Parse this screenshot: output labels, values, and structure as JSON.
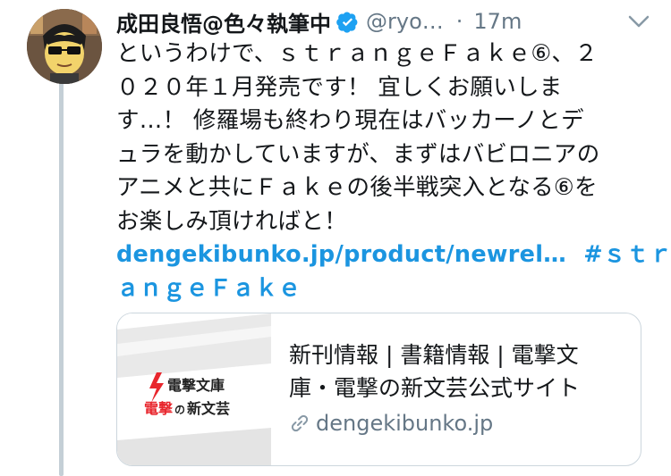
{
  "tweet": {
    "display_name": "成田良悟@色々執筆中",
    "handle": "@ryo…",
    "separator": "·",
    "timestamp": "17m",
    "body_lines": [
      "というわけで、ｓｔｒａｎｇｅＦａｋｅ⑥、２",
      "０２０年１月発売です！ 宜しくお願いしま",
      "す…！ 修羅場も終わり現在はバッカーノとデ",
      "ュラを動かしていますが、まずはバビロニアの",
      "アニメと共にＦａｋｅの後半戦突入となる⑥を",
      "お楽しみ頂ければと！"
    ],
    "link_text": "dengekibunko.jp/product/newrel…",
    "hashtag_part1": "#ｓｔｒ",
    "hashtag_part2": "ａｎｇｅＦａｋｅ",
    "icons": [
      "avatar",
      "verified-badge-icon",
      "chevron-down-icon",
      "link-icon"
    ],
    "accent_color": "#1b95e0"
  },
  "card": {
    "title_lines": [
      "新刊情報 | 書籍情報 | 電撃文",
      "庫・電撃の新文芸公式サイト"
    ],
    "url": "dengekibunko.jp",
    "logo_line1": "電撃文庫",
    "logo_line2_part1": "電撃",
    "logo_line2_part2": "の",
    "logo_line2_part3": "新文芸"
  }
}
